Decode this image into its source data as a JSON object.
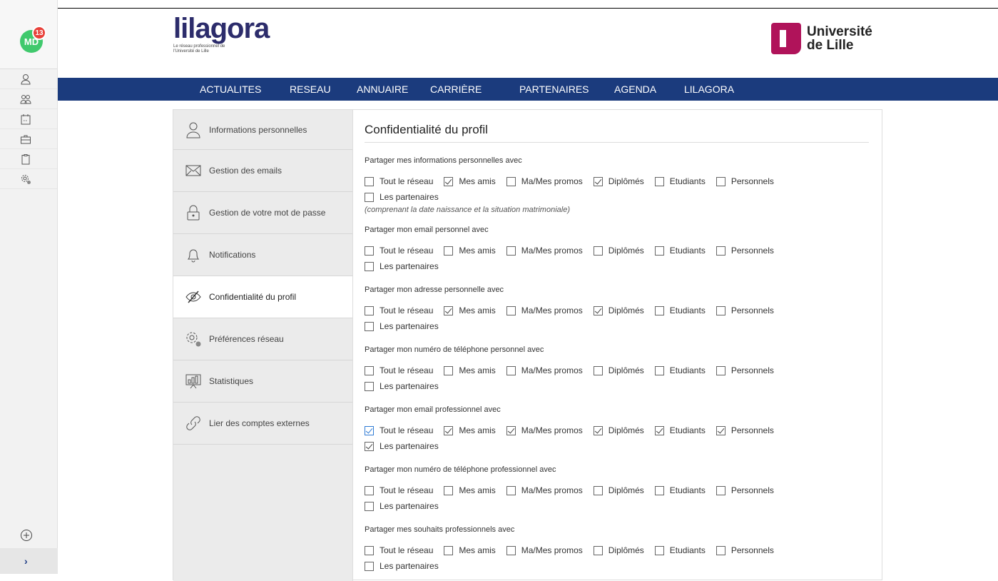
{
  "rail": {
    "avatar_initials": "MD",
    "notification_count": "13",
    "items": [
      "user-icon",
      "group-icon",
      "calendar-icon",
      "briefcase-icon",
      "clipboard-icon",
      "settings-icon"
    ],
    "plus_icon": "plus-circle-icon",
    "expand_label": "›"
  },
  "header": {
    "logo_word": "lilagora",
    "logo_sub": "Le réseau professionnel de l'Université de Lille",
    "univ_line1": "Université",
    "univ_line2": "de Lille"
  },
  "nav": {
    "items": [
      "ACTUALITES",
      "RESEAU",
      "ANNUAIRE",
      "CARRIÈRE",
      "PARTENAIRES",
      "AGENDA",
      "LILAGORA"
    ]
  },
  "sidebar": {
    "items": [
      {
        "label": "Informations personnelles",
        "icon": "user-icon"
      },
      {
        "label": "Gestion des emails",
        "icon": "envelope-icon"
      },
      {
        "label": "Gestion de votre mot de passe",
        "icon": "lock-icon"
      },
      {
        "label": "Notifications",
        "icon": "bell-icon"
      },
      {
        "label": "Confidentialité du profil",
        "icon": "eye-slash-icon",
        "active": true
      },
      {
        "label": "Préférences réseau",
        "icon": "settings-icon"
      },
      {
        "label": "Statistiques",
        "icon": "chart-icon"
      },
      {
        "label": "Lier des comptes externes",
        "icon": "link-icon"
      }
    ]
  },
  "main": {
    "title": "Confidentialité du profil",
    "option_labels": [
      "Tout le réseau",
      "Mes amis",
      "Ma/Mes promos",
      "Diplômés",
      "Etudiants",
      "Personnels",
      "Les partenaires"
    ],
    "sections": [
      {
        "label": "Partager mes informations personnelles avec",
        "checked": [
          false,
          true,
          false,
          true,
          false,
          false,
          false
        ],
        "note": "(comprenant la date naissance et la situation matrimoniale)"
      },
      {
        "label": "Partager mon email personnel avec",
        "checked": [
          false,
          false,
          false,
          false,
          false,
          false,
          false
        ]
      },
      {
        "label": "Partager mon adresse personnelle avec",
        "checked": [
          false,
          true,
          false,
          true,
          false,
          false,
          false
        ]
      },
      {
        "label": "Partager mon numéro de téléphone personnel avec",
        "checked": [
          false,
          false,
          false,
          false,
          false,
          false,
          false
        ]
      },
      {
        "label": "Partager mon email professionnel avec",
        "checked": [
          true,
          true,
          true,
          true,
          true,
          true,
          true
        ],
        "focus_first": true
      },
      {
        "label": "Partager mon numéro de téléphone professionnel avec",
        "checked": [
          false,
          false,
          false,
          false,
          false,
          false,
          false
        ]
      },
      {
        "label": "Partager mes souhaits professionnels avec",
        "checked": [
          false,
          false,
          false,
          false,
          false,
          false,
          false
        ]
      }
    ]
  }
}
